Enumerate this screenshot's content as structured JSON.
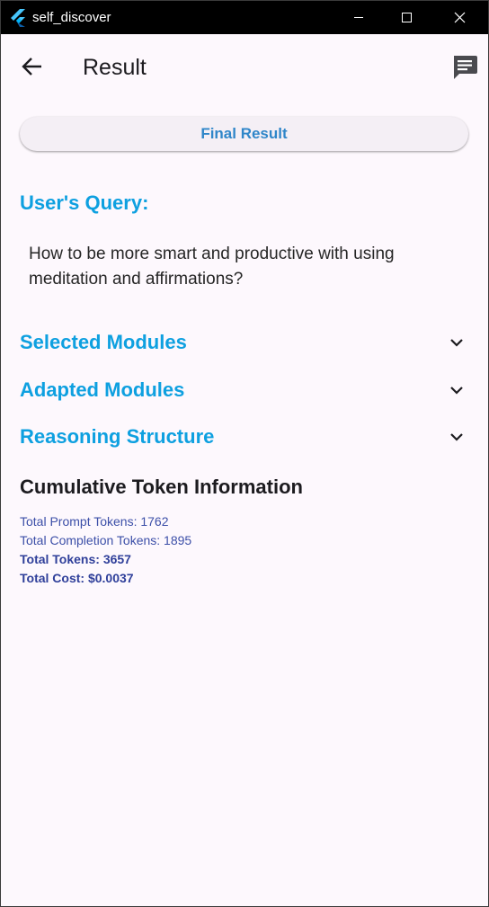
{
  "window": {
    "title": "self_discover",
    "controls": [
      "minimize-icon",
      "maximize-icon",
      "close-icon"
    ]
  },
  "appbar": {
    "title": "Result",
    "back_icon": "arrow-back-icon",
    "action_icon": "chat-icon"
  },
  "final_result_button": {
    "label": "Final Result"
  },
  "query": {
    "heading": "User's Query:",
    "text": "How to be more smart and productive with using meditation and affirmations?"
  },
  "expanders": [
    {
      "label": "Selected Modules",
      "icon": "chevron-down-icon"
    },
    {
      "label": "Adapted Modules",
      "icon": "chevron-down-icon"
    },
    {
      "label": "Reasoning Structure",
      "icon": "chevron-down-icon"
    }
  ],
  "tokens": {
    "title": "Cumulative Token Information",
    "prompt": "Total Prompt Tokens: 1762",
    "completion": "Total Completion Tokens: 1895",
    "total": "Total Tokens: 3657",
    "cost": "Total Cost: $0.0037"
  },
  "colors": {
    "heading_accent": "#0ea0e0",
    "button_text": "#2f86c9",
    "token_text": "#3c4fa8",
    "background": "#fdf8fd",
    "titlebar": "#000000"
  }
}
